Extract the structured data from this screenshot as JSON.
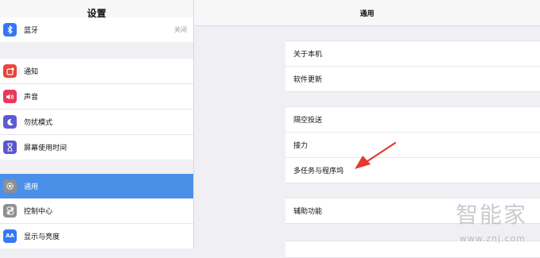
{
  "sidebar": {
    "title": "设置",
    "bluetooth": {
      "label": "蓝牙",
      "value": "关闭",
      "icon": "bluetooth-icon",
      "color": "#3478f6"
    },
    "items_group1": [
      {
        "label": "通知",
        "icon": "notifications-icon",
        "color": "#e8463c"
      },
      {
        "label": "声音",
        "icon": "sound-icon",
        "color": "#e9385a"
      },
      {
        "label": "勿扰模式",
        "icon": "moon-icon",
        "color": "#5c5ad6"
      },
      {
        "label": "屏幕使用时间",
        "icon": "hourglass-icon",
        "color": "#5a58cf"
      }
    ],
    "items_group2": [
      {
        "label": "通用",
        "icon": "gear-icon",
        "color": "#8e8e93",
        "selected": true
      },
      {
        "label": "控制中心",
        "icon": "control-center-icon",
        "color": "#8e8e93"
      },
      {
        "label": "显示与亮度",
        "icon": "display-brightness-icon",
        "color": "#3478f6",
        "glyph": "AA"
      }
    ]
  },
  "main": {
    "title": "通用",
    "group1": [
      "关于本机",
      "软件更新"
    ],
    "group2": [
      "隔空投送",
      "接力",
      "多任务与程序坞"
    ],
    "group3": [
      "辅助功能"
    ]
  },
  "watermark": {
    "logo": "智能家",
    "url": "www.znj.com"
  },
  "annotation": {
    "color": "#e23a2f"
  }
}
